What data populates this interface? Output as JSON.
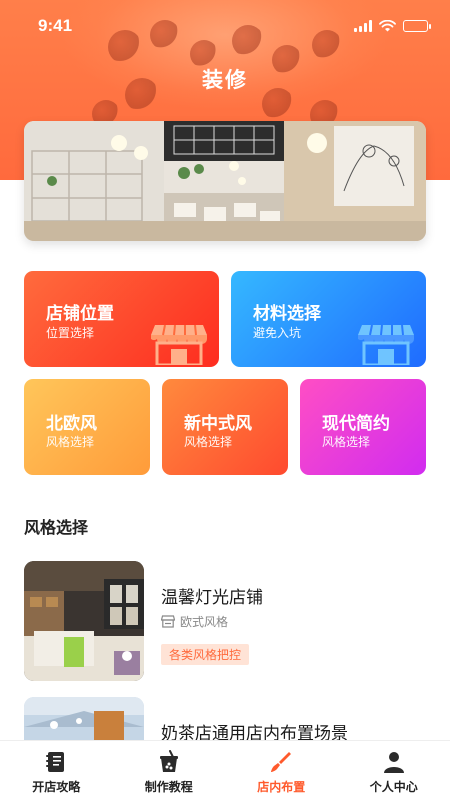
{
  "status_bar": {
    "time": "9:41"
  },
  "header": {
    "title": "装修"
  },
  "categories": [
    {
      "title": "店铺位置",
      "subtitle": "位置选择"
    },
    {
      "title": "材料选择",
      "subtitle": "避免入坑"
    },
    {
      "title": "北欧风",
      "subtitle": "风格选择"
    },
    {
      "title": "新中式风",
      "subtitle": "风格选择"
    },
    {
      "title": "现代简约",
      "subtitle": "风格选择"
    }
  ],
  "style_section": {
    "title": "风格选择",
    "items": [
      {
        "title": "温馨灯光店铺",
        "meta": "欧式风格",
        "tag": "各类风格把控"
      },
      {
        "title": "奶茶店通用店内布置场景"
      }
    ]
  },
  "bottom_nav": [
    {
      "label": "开店攻略",
      "icon": "notebook-icon",
      "active": false
    },
    {
      "label": "制作教程",
      "icon": "drink-cup-icon",
      "active": false
    },
    {
      "label": "店内布置",
      "icon": "paint-brush-icon",
      "active": true
    },
    {
      "label": "个人中心",
      "icon": "user-icon",
      "active": false
    }
  ],
  "colors": {
    "brand": "#ff6a3d",
    "active_nav": "#ff5a2c"
  }
}
